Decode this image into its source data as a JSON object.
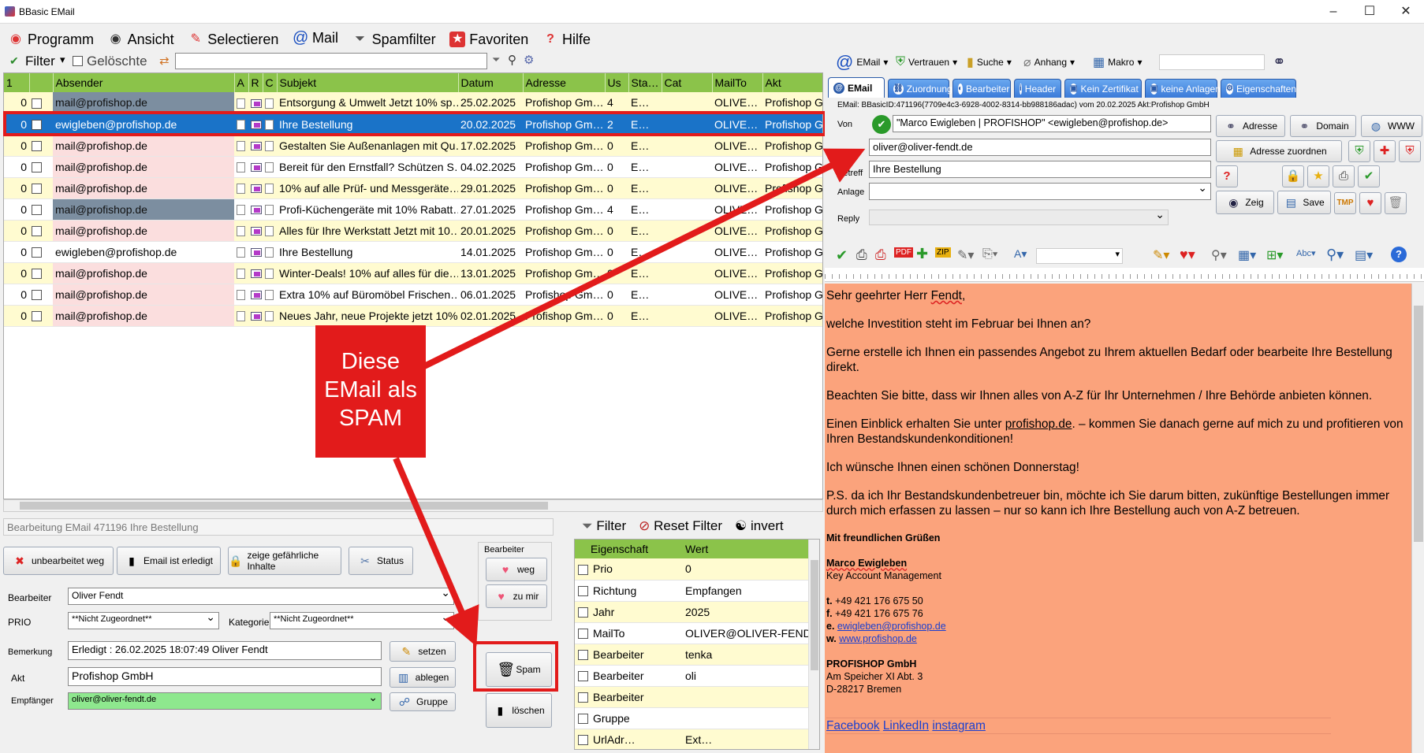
{
  "window": {
    "title": "BBasic EMail",
    "minimize": "–",
    "maximize": "☐",
    "close": "✕"
  },
  "menu": [
    {
      "label": "Programm",
      "icon": "program-icon",
      "glyph": "◉",
      "color": "#d33"
    },
    {
      "label": "Ansicht",
      "icon": "eye-icon",
      "glyph": "👁",
      "color": "#333"
    },
    {
      "label": "Selectieren",
      "icon": "pin-icon",
      "glyph": "📌",
      "color": "#d33"
    },
    {
      "label": "Mail",
      "icon": "at-icon",
      "glyph": "@",
      "color": "#1a4fc0"
    },
    {
      "label": "Spamfilter",
      "icon": "funnel-icon",
      "glyph": "⏷",
      "color": "#555"
    },
    {
      "label": "Favoriten",
      "icon": "star-icon",
      "glyph": "★",
      "color": "#d33"
    },
    {
      "label": "Hilfe",
      "icon": "help-icon",
      "glyph": "?",
      "color": "#d33"
    }
  ],
  "filterbar": {
    "filter_label": "Filter",
    "deleted_label": "Gelöschte",
    "search_value": ""
  },
  "grid": {
    "columns": [
      "1",
      "",
      "Absender",
      "A",
      "R",
      "C",
      "Subjekt",
      "Datum",
      "Adresse",
      "Us",
      "Sta…",
      "Cat",
      "MailTo",
      "Akt"
    ],
    "rows": [
      {
        "n": "0",
        "sender": "mail@profishop.de",
        "subject": "Entsorgung & Umwelt  Jetzt 10% sp…",
        "date": "25.02.2025",
        "address": "Profishop Gm…",
        "us": "4",
        "sta": "E…",
        "cat": "",
        "mailto": "OLIVE…",
        "akt": "Profishop Gm",
        "row": "yellow",
        "sender_bg": "gray"
      },
      {
        "n": "0",
        "sender": "ewigleben@profishop.de",
        "subject": "Ihre Bestellung",
        "date": "20.02.2025",
        "address": "Profishop Gm…",
        "us": "2",
        "sta": "E…",
        "cat": "",
        "mailto": "OLIVE…",
        "akt": "Profishop Gm",
        "row": "sel",
        "sender_bg": "pink"
      },
      {
        "n": "0",
        "sender": "mail@profishop.de",
        "subject": "Gestalten Sie Außenanlagen mit Qu…",
        "date": "17.02.2025",
        "address": "Profishop Gm…",
        "us": "0",
        "sta": "E…",
        "cat": "",
        "mailto": "OLIVE…",
        "akt": "Profishop Gm",
        "row": "yellow",
        "sender_bg": "pink"
      },
      {
        "n": "0",
        "sender": "mail@profishop.de",
        "subject": "Bereit für den Ernstfall?  Schützen S…",
        "date": "04.02.2025",
        "address": "Profishop Gm…",
        "us": "0",
        "sta": "E…",
        "cat": "",
        "mailto": "OLIVE…",
        "akt": "Profishop Gm",
        "row": "white",
        "sender_bg": "pink"
      },
      {
        "n": "0",
        "sender": "mail@profishop.de",
        "subject": "10% auf alle Prüf- und Messgeräte…",
        "date": "29.01.2025",
        "address": "Profishop Gm…",
        "us": "0",
        "sta": "E…",
        "cat": "",
        "mailto": "OLIVE…",
        "akt": "Profishop Gm",
        "row": "yellow",
        "sender_bg": "pink"
      },
      {
        "n": "0",
        "sender": "mail@profishop.de",
        "subject": "Profi-Küchengeräte mit 10% Rabatt…",
        "date": "27.01.2025",
        "address": "Profishop Gm…",
        "us": "4",
        "sta": "E…",
        "cat": "",
        "mailto": "OLIVE…",
        "akt": "Profishop Gm",
        "row": "white",
        "sender_bg": "gray"
      },
      {
        "n": "0",
        "sender": "mail@profishop.de",
        "subject": "Alles für Ihre Werkstatt  Jetzt mit 10…",
        "date": "20.01.2025",
        "address": "Profishop Gm…",
        "us": "0",
        "sta": "E…",
        "cat": "",
        "mailto": "OLIVE…",
        "akt": "Profishop Gm",
        "row": "yellow",
        "sender_bg": "pink"
      },
      {
        "n": "0",
        "sender": "ewigleben@profishop.de",
        "subject": "Ihre Bestellung",
        "date": "14.01.2025",
        "address": "Profishop Gm…",
        "us": "0",
        "sta": "E…",
        "cat": "",
        "mailto": "OLIVE…",
        "akt": "Profishop Gm",
        "row": "white",
        "sender_bg": "white"
      },
      {
        "n": "0",
        "sender": "mail@profishop.de",
        "subject": "Winter-Deals!  10% auf alles für die…",
        "date": "13.01.2025",
        "address": "Profishop Gm…",
        "us": "0",
        "sta": "E…",
        "cat": "",
        "mailto": "OLIVE…",
        "akt": "Profishop Gm",
        "row": "yellow",
        "sender_bg": "pink"
      },
      {
        "n": "0",
        "sender": "mail@profishop.de",
        "subject": "Extra 10% auf Büromöbel  Frischen…",
        "date": "06.01.2025",
        "address": "Profishop Gm…",
        "us": "0",
        "sta": "E…",
        "cat": "",
        "mailto": "OLIVE…",
        "akt": "Profishop Gm",
        "row": "white",
        "sender_bg": "pink"
      },
      {
        "n": "0",
        "sender": "mail@profishop.de",
        "subject": "Neues Jahr, neue Projekte jetzt 10%…",
        "date": "02.01.2025",
        "address": "Profishop Gm…",
        "us": "0",
        "sta": "E…",
        "cat": "",
        "mailto": "OLIVE…",
        "akt": "Profishop Gm",
        "row": "yellow",
        "sender_bg": "pink"
      }
    ]
  },
  "edit": {
    "title": "Bearbeitung EMail 471196 Ihre Bestellung",
    "btn_unbearbeitet": "unbearbeitet weg",
    "btn_erledigt": "Email ist erledigt",
    "btn_gefaehrlich": "zeige gefährliche Inhalte",
    "btn_status": "Status",
    "bearbeiter_group": "Bearbeiter",
    "btn_weg": "weg",
    "btn_zumir": "zu mir",
    "lbl_bearbeiter": "Bearbeiter",
    "val_bearbeiter": "Oliver Fendt",
    "lbl_prio": "PRIO",
    "val_prio": "**Nicht Zugeordnet**",
    "lbl_kategorie": "Kategorie",
    "val_kategorie": "**Nicht Zugeordnet**",
    "lbl_bemerkung": "Bemerkung",
    "val_bemerkung": "Erledigt : 26.02.2025 18:07:49 Oliver Fendt",
    "lbl_akt": "Akt",
    "val_akt": "Profishop GmbH",
    "lbl_empfaenger": "Empfänger",
    "val_empfaenger": "oliver@oliver-fendt.de",
    "btn_setzen": "setzen",
    "btn_ablegen": "ablegen",
    "btn_gruppe": "Gruppe",
    "btn_spam": "Spam",
    "btn_loeschen": "löschen"
  },
  "propfilter": {
    "filter": "Filter",
    "reset": "Reset Filter",
    "invert": "invert"
  },
  "props": {
    "columns": [
      "Eigenschaft",
      "Wert"
    ],
    "rows": [
      {
        "k": "Prio",
        "v": "0",
        "row": "yellow"
      },
      {
        "k": "Richtung",
        "v": "Empfangen",
        "row": "white"
      },
      {
        "k": "Jahr",
        "v": "2025",
        "row": "yellow"
      },
      {
        "k": "MailTo",
        "v": "OLIVER@OLIVER-FENDT.DE",
        "row": "white"
      },
      {
        "k": "Bearbeiter",
        "v": "tenka",
        "row": "yellow"
      },
      {
        "k": "Bearbeiter",
        "v": "oli",
        "row": "white"
      },
      {
        "k": "Bearbeiter",
        "v": "",
        "row": "yellow"
      },
      {
        "k": "Gruppe",
        "v": "",
        "row": "white"
      },
      {
        "k": "UrlAdr…",
        "v": "Ext…",
        "row": "yellow"
      }
    ]
  },
  "rtoolbar": {
    "email": "EMail",
    "vertrauen": "Vertrauen",
    "suche": "Suche",
    "anhang": "Anhang",
    "makro": "Makro"
  },
  "tabs": [
    {
      "label": "EMail",
      "icon": "at-icon"
    },
    {
      "label": "Zuordnung",
      "icon": "link-icon"
    },
    {
      "label": "Bearbeiter",
      "icon": "user-icon"
    },
    {
      "label": "Header",
      "icon": "info-icon"
    },
    {
      "label": "Kein Zertifikat",
      "icon": "certificate-icon"
    },
    {
      "label": "keine Anlagen",
      "icon": "attachment-icon"
    },
    {
      "label": "Eigenschaften",
      "icon": "gear-icon"
    }
  ],
  "header": {
    "id_line": "EMail: BBasicID:471196(7709e4c3-6928-4002-8314-bb988186adac) vom 20.02.2025 Akt:Profishop GmbH",
    "lbl_von": "Von",
    "von": "\"Marco Ewigleben | PROFISHOP\" <ewigleben@profishop.de>",
    "an": "oliver@oliver-fendt.de",
    "lbl_betreff": "Betreff",
    "betreff": "Ihre Bestellung",
    "lbl_anlage": "Anlage",
    "lbl_reply": "Reply",
    "btn_adresse": "Adresse",
    "btn_domain": "Domain",
    "btn_www": "WWW",
    "btn_adresse_zuordnen": "Adresse zuordnen",
    "btn_zeig": "Zeig",
    "btn_save": "Save"
  },
  "body": {
    "greeting_pre": "Sehr geehrter Herr ",
    "greeting_name": "Fendt",
    "greeting_post": ",",
    "p1": "welche Investition steht im Februar bei Ihnen an?",
    "p2": "Gerne erstelle ich Ihnen ein passendes Angebot zu Ihrem aktuellen Bedarf oder bearbeite Ihre Bestellung direkt.",
    "p3": "Beachten Sie bitte, dass wir Ihnen alles von A-Z für Ihr Unternehmen / Ihre Behörde anbieten können.",
    "p4_pre": "Einen Einblick erhalten Sie unter ",
    "p4_link": "profishop.de",
    "p4_post": ". – kommen Sie danach gerne auf mich zu und profitieren von Ihren Bestandskundenkonditionen!",
    "p5": "Ich wünsche Ihnen einen schönen Donnerstag!",
    "p6": "P.S. da ich Ihr Bestandskundenbetreuer bin, möchte ich Sie darum bitten, zukünftige Bestellungen immer durch mich erfassen zu lassen – nur so kann ich Ihre Bestellung auch von A-Z betreuen.",
    "closing": "Mit freundlichen Grüßen",
    "sig_name": "Marco Ewigleben",
    "sig_role": "Key Account Management",
    "t_lbl": "t.",
    "t": "+49 421 176 675 50",
    "f_lbl": "f.",
    "f": "+49 421 176 675 76",
    "e_lbl": "e.",
    "e": "ewigleben@profishop.de",
    "w_lbl": "w.",
    "w": "www.profishop.de",
    "company": "PROFISHOP GmbH",
    "street": "Am Speicher XI Abt. 3",
    "city": "D-28217 Bremen",
    "social": [
      "Facebook",
      "LinkedIn",
      "instagram"
    ]
  },
  "callout": {
    "line1": "Diese",
    "line2": "EMail als",
    "line3": "SPAM",
    "color": "#e21b1b"
  }
}
